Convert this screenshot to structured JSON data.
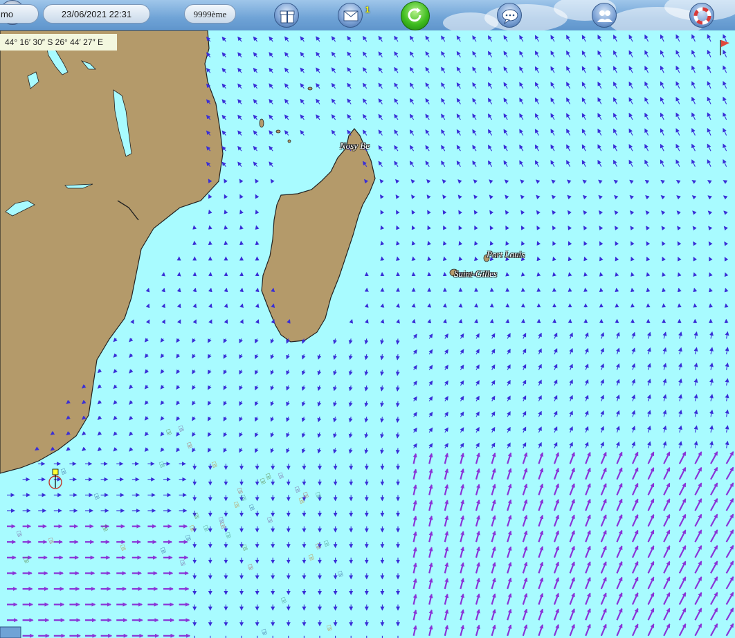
{
  "toolbar": {
    "boat_name": "mo",
    "date": "23/06/2021 22:31",
    "clock_badge": "1",
    "rank": "9999ème",
    "icons": [
      "gift-icon",
      "mail-icon",
      "refresh-icon",
      "chat-icon",
      "friends-icon",
      "lifebuoy-icon"
    ]
  },
  "map": {
    "coordinates": "44° 16′ 30″ S 26° 44′ 27″ E",
    "places": {
      "nosy_be": "Nosy Be",
      "port_louis": "Port Louis",
      "saint_gilles": "Saint-Gilles"
    },
    "colors": {
      "sea": "#a8fbff",
      "land": "#b49a6a",
      "wind_arrow_light": "#3a2fd6",
      "wind_arrow_strong": "#8a33d6"
    }
  }
}
